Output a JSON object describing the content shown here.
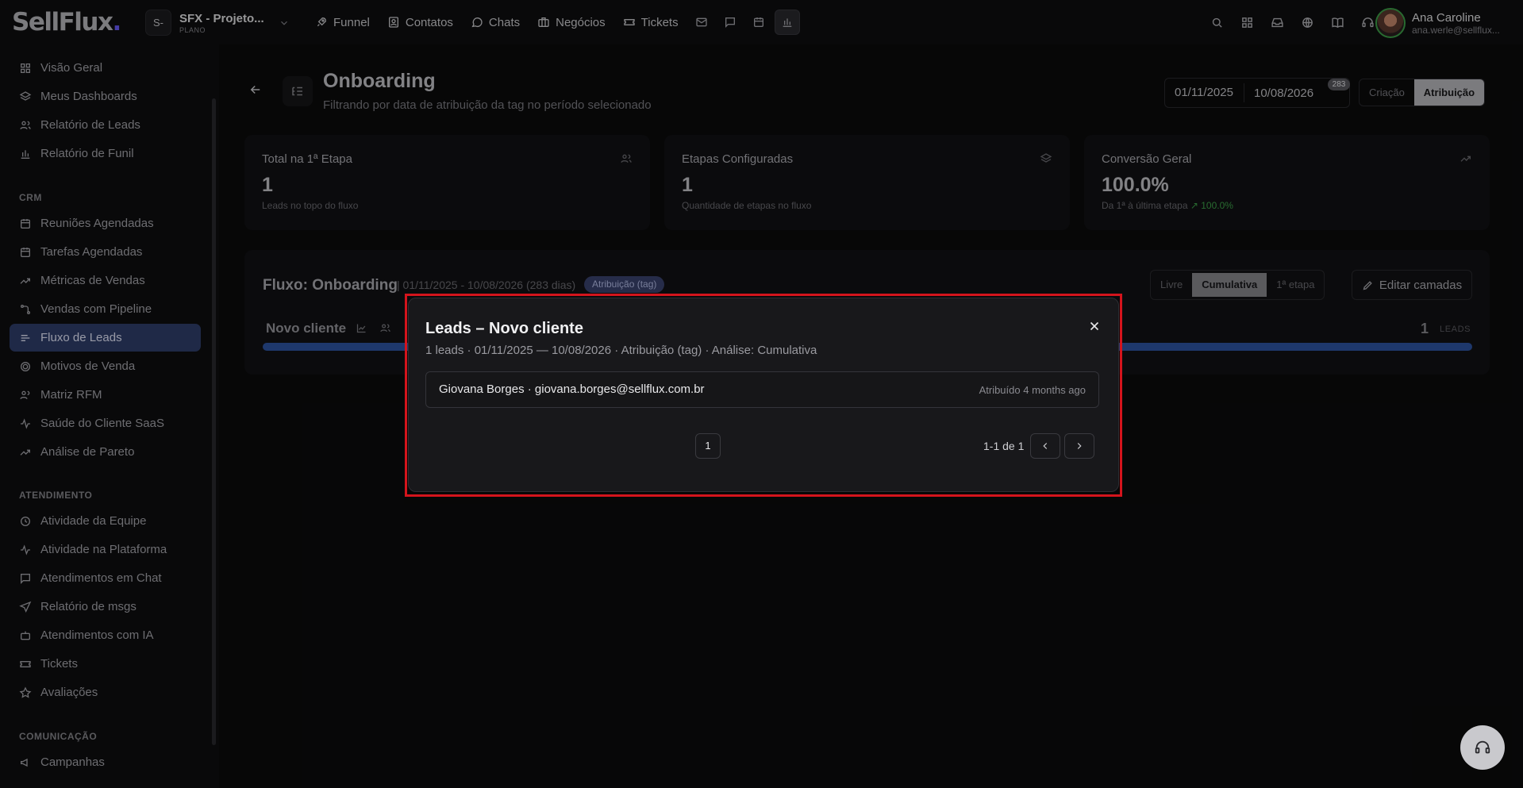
{
  "topbar": {
    "logo_main": "SellFlux",
    "logo_dot": ".",
    "project_badge": "S-",
    "project_name": "SFX - Projeto...",
    "project_plan": "PLANO",
    "nav": [
      {
        "label": "Funnel",
        "icon": "rocket-icon"
      },
      {
        "label": "Contatos",
        "icon": "contacts-icon"
      },
      {
        "label": "Chats",
        "icon": "chat-bubble-icon"
      },
      {
        "label": "Negócios",
        "icon": "briefcase-icon"
      },
      {
        "label": "Tickets",
        "icon": "ticket-icon"
      }
    ],
    "user_name": "Ana Caroline",
    "user_email": "ana.werle@sellflux..."
  },
  "sidebar": {
    "group1": [
      "Visão Geral",
      "Meus Dashboards",
      "Relatório de Leads",
      "Relatório de Funil"
    ],
    "crm_title": "CRM",
    "crm": [
      "Reuniões Agendadas",
      "Tarefas Agendadas",
      "Métricas de Vendas",
      "Vendas com Pipeline",
      "Fluxo de Leads",
      "Motivos de Venda",
      "Matriz RFM",
      "Saúde do Cliente SaaS",
      "Análise de Pareto"
    ],
    "atendimento_title": "ATENDIMENTO",
    "atendimento": [
      "Atividade da Equipe",
      "Atividade na Plataforma",
      "Atendimentos em Chat",
      "Relatório de msgs",
      "Atendimentos com IA",
      "Tickets",
      "Avaliações"
    ],
    "comunicacao_title": "COMUNICAÇÃO",
    "comunicacao": [
      "Campanhas"
    ],
    "active": "Fluxo de Leads"
  },
  "page": {
    "title": "Onboarding",
    "subtitle": "Filtrando por data de atribuição da tag no período selecionado",
    "date_start": "01/11/2025",
    "date_end": "10/08/2026",
    "days_badge": "283",
    "mode_options": [
      "Criação",
      "Atribuição"
    ],
    "mode_selected": "Atribuição"
  },
  "cards": [
    {
      "label": "Total na 1ª Etapa",
      "value": "1",
      "sub": "Leads no topo do fluxo",
      "icon": "users-icon"
    },
    {
      "label": "Etapas Configuradas",
      "value": "1",
      "sub": "Quantidade de etapas no fluxo",
      "icon": "layers-icon"
    },
    {
      "label": "Conversão Geral",
      "value": "100.0%",
      "sub": "Da 1ª à última etapa",
      "trend": "100.0%",
      "icon": "trending-up-icon"
    }
  ],
  "flow": {
    "title": "Fluxo: Onboarding",
    "meta": "| 01/11/2025 - 10/08/2026 (283 dias)",
    "tag": "Atribuição (tag)",
    "view_options": [
      "Livre",
      "Cumulativa",
      "1ª etapa"
    ],
    "view_selected": "Cumulativa",
    "edit_label": "Editar camadas",
    "stage_name": "Novo cliente",
    "stage_count": "1",
    "stage_unit": "LEADS"
  },
  "modal": {
    "title": "Leads – Novo cliente",
    "subtitle": "1 leads · 01/11/2025 — 10/08/2026 · Atribuição (tag) · Análise: Cumulativa",
    "row_lead": "Giovana Borges · giovana.borges@sellflux.com.br",
    "row_time": "Atribuído 4 months ago",
    "page": "1",
    "range": "1-1 de 1"
  }
}
